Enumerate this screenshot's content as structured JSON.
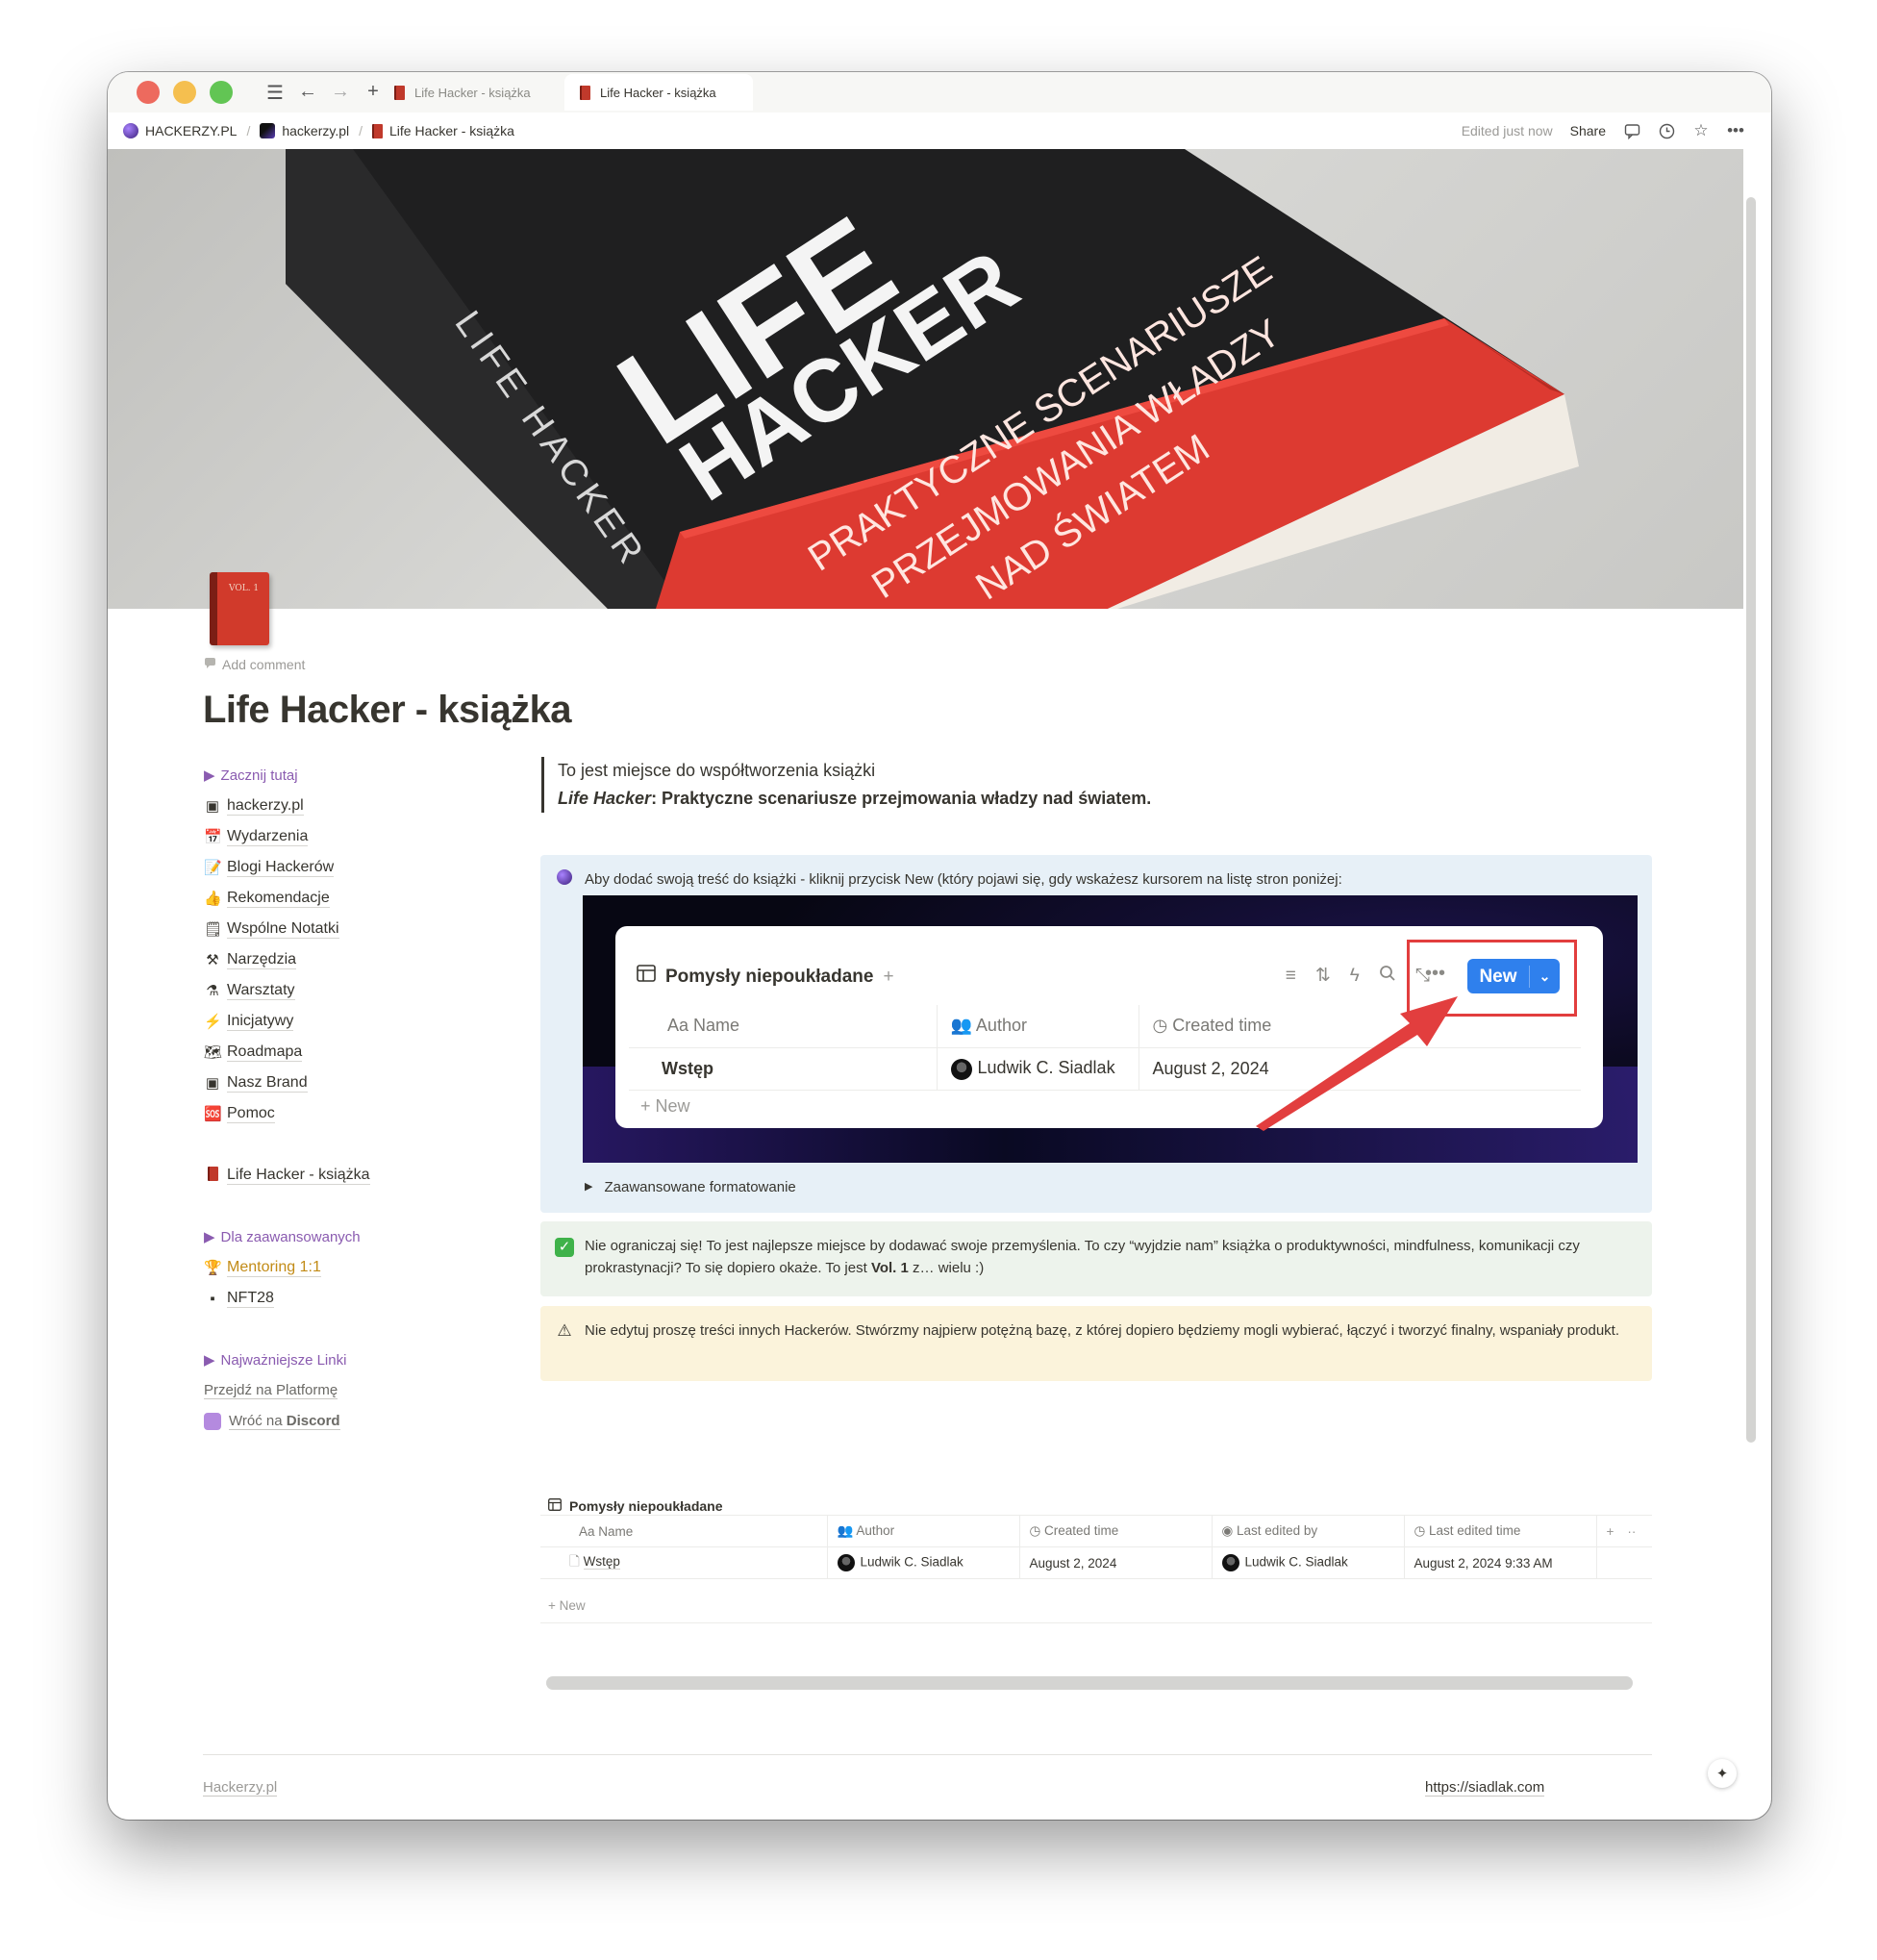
{
  "window": {
    "traffic_colors": [
      "#ed6a5e",
      "#f5bf4f",
      "#62c554"
    ],
    "tabs": [
      {
        "label": "Life Hacker - książka",
        "active": false
      },
      {
        "label": "Life Hacker - książka",
        "active": true
      }
    ]
  },
  "breadcrumb": {
    "items": [
      "HACKERZY.PL",
      "hackerzy.pl",
      "Life Hacker - książka"
    ],
    "edited": "Edited just now",
    "share": "Share"
  },
  "cover": {
    "title_line1": "LIFE",
    "title_line2": "HACKER",
    "spine": "LIFE HACKER",
    "subtitle": [
      "PRAKTYCZNE SCENARIUSZE",
      "PRZEJMOWANIA WŁADZY",
      "NAD ŚWIATEM"
    ]
  },
  "page": {
    "icon_label": "VOL. 1",
    "add_comment": "Add comment",
    "title": "Life Hacker - książka"
  },
  "sidebar": {
    "toggle_start": "Zacznij tutaj",
    "items": [
      {
        "emoji": "▣",
        "label": "hackerzy.pl"
      },
      {
        "emoji": "📅",
        "label": "Wydarzenia"
      },
      {
        "emoji": "📝",
        "label": "Blogi Hackerów"
      },
      {
        "emoji": "👍",
        "label": "Rekomendacje"
      },
      {
        "emoji": "🗒",
        "label": "Wspólne Notatki"
      },
      {
        "emoji": "⚒",
        "label": "Narzędzia"
      },
      {
        "emoji": "⚗",
        "label": "Warsztaty"
      },
      {
        "emoji": "⚡",
        "label": "Inicjatywy"
      },
      {
        "emoji": "🗺",
        "label": "Roadmapa"
      },
      {
        "emoji": "▣",
        "label": "Nasz Brand"
      },
      {
        "emoji": "🆘",
        "label": "Pomoc"
      }
    ],
    "current": "Life Hacker - książka",
    "toggle_advanced": "Dla zaawansowanych",
    "mentoring": "Mentoring 1:1",
    "nft": "NFT28",
    "toggle_links": "Najważniejsze Linki",
    "link_platform": "Przejdź na Platformę",
    "link_discord_prefix": "Wróć na ",
    "link_discord_bold": "Discord"
  },
  "quote": {
    "line1": "To jest miejsce do współtworzenia książki",
    "line2_italic": "Life Hacker",
    "line2_rest": ": Praktyczne scenariusze przejmowania władzy nad światem."
  },
  "callout_info": {
    "text": "Aby dodać swoją treść do książki - kliknij przycisk New (który pojawi się, gdy wskażesz kursorem na listę stron poniżej:",
    "screenshot": {
      "db_title": "Pomysły niepoukładane",
      "new_button": "New",
      "columns": [
        "Aa Name",
        "Author",
        "Created time"
      ],
      "row": [
        "Wstęp",
        "Ludwik C. Siadlak",
        "August 2, 2024"
      ],
      "new_row": "New"
    },
    "toggle": "Zaawansowane formatowanie"
  },
  "callout_success": {
    "text_before": "Nie ograniczaj się! To jest najlepsze miejsce by dodawać swoje przemyślenia. To czy “wyjdzie nam” książka o produktywności, mindfulness, komunikacji czy prokrastynacji? To się dopiero okaże. To jest ",
    "text_bold": "Vol. 1",
    "text_after": " z… wielu :)"
  },
  "callout_warning": {
    "text": "Nie edytuj proszę treści innych Hackerów. Stwórzmy najpierw potężną bazę, z której dopiero będziemy mogli wybierać, łączyć i tworzyć finalny, wspaniały produkt."
  },
  "database": {
    "title": "Pomysły niepoukładane",
    "columns": [
      "Aa Name",
      "Author",
      "Created time",
      "Last edited by",
      "Last edited time"
    ],
    "rows": [
      [
        "Wstęp",
        "Ludwik C. Siadlak",
        "August 2, 2024",
        "Ludwik C. Siadlak",
        "August 2, 2024 9:33 AM"
      ]
    ],
    "new_row": "New"
  },
  "footer": {
    "left": "Hackerzy.pl",
    "right": "https://siadlak.com"
  }
}
